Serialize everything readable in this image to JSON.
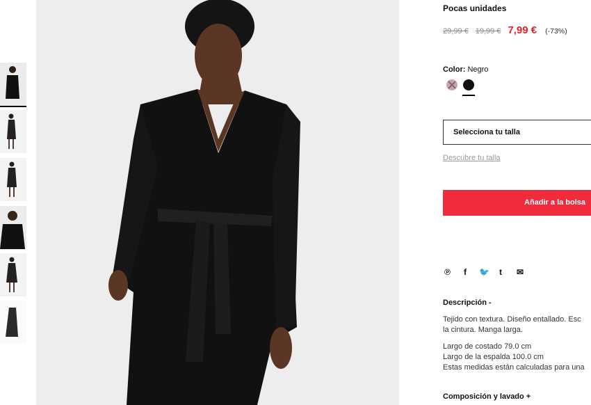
{
  "product": {
    "stock_status": "Pocas unidades",
    "price_original": "29,99 €",
    "price_previous": "19,99 €",
    "price_current": "7,99 €",
    "discount": "(-73%)",
    "color_label": "Color:",
    "color_value": "Negro",
    "swatches": [
      {
        "name": "pink",
        "color": "#c99aa7",
        "available": false
      },
      {
        "name": "black",
        "color": "#111111",
        "available": true,
        "selected": true
      }
    ],
    "size_placeholder": "Selecciona tu talla",
    "size_guide_link": "Descubre tu talla",
    "add_to_bag": "Añadir a la bolsa",
    "description_title": "Descripción -",
    "description_lines": [
      "Tejido con textura. Diseño entallado. Esc",
      "la cintura. Manga larga."
    ],
    "measurement_lines": [
      "Largo de costado 79.0 cm",
      "Largo de la espalda 100.0 cm",
      "Estas medidas están calculadas para una"
    ],
    "composition_title": "Composición y lavado +"
  },
  "share_icons": [
    "pinterest-icon",
    "facebook-icon",
    "twitter-icon",
    "tumblr-icon",
    "mail-icon"
  ],
  "share_glyphs": [
    "℗",
    "f",
    "🐦",
    "t",
    "✉"
  ],
  "colors": {
    "accent": "#ef2b3c",
    "price": "#e5232d"
  }
}
